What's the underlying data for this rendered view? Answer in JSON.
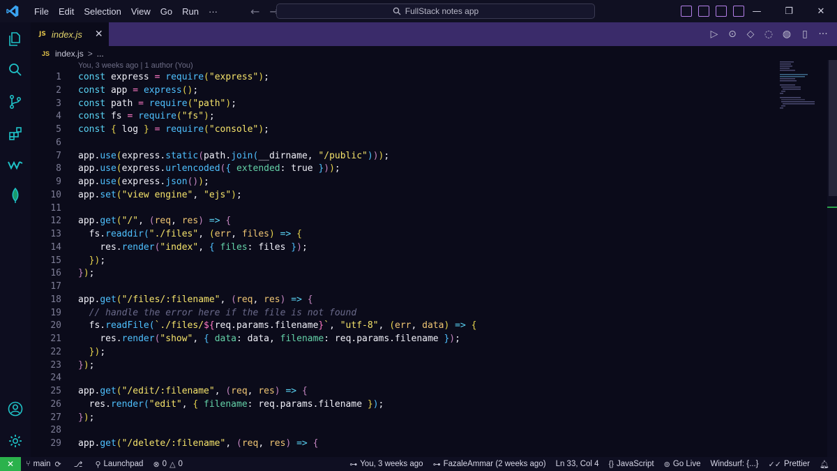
{
  "menu": [
    "File",
    "Edit",
    "Selection",
    "View",
    "Go",
    "Run",
    "···"
  ],
  "command_center": "FullStack notes app",
  "window_controls": {
    "minimize": "—",
    "restore": "❐",
    "close": "✕"
  },
  "tab": {
    "lang": "JS",
    "name": "index.js",
    "close": "✕"
  },
  "breadcrumb": {
    "lang": "JS",
    "file": "index.js",
    "sep": ">",
    "more": "..."
  },
  "codelens": "You, 3 weeks ago | 1 author (You)",
  "editor_actions": [
    "▷",
    "⊙",
    "◇",
    "◌",
    "◍",
    "▯",
    "···"
  ],
  "code_lines": [
    {
      "n": "1",
      "html": "<span class='kw'>const</span> <span class='var'>express</span> <span class='op'>=</span> <span class='fn'>require</span><span class='pun'>(</span><span class='str'>\"express\"</span><span class='pun'>)</span><span class='var'>;</span>"
    },
    {
      "n": "2",
      "html": "<span class='kw'>const</span> <span class='var'>app</span> <span class='op'>=</span> <span class='fn'>express</span><span class='pun'>()</span><span class='var'>;</span>"
    },
    {
      "n": "3",
      "html": "<span class='kw'>const</span> <span class='var'>path</span> <span class='op'>=</span> <span class='fn'>require</span><span class='pun'>(</span><span class='str'>\"path\"</span><span class='pun'>)</span><span class='var'>;</span>"
    },
    {
      "n": "4",
      "html": "<span class='kw'>const</span> <span class='var'>fs</span> <span class='op'>=</span> <span class='fn'>require</span><span class='pun'>(</span><span class='str'>\"fs\"</span><span class='pun'>)</span><span class='var'>;</span>"
    },
    {
      "n": "5",
      "html": "<span class='kw'>const</span> <span class='pun'>{</span> <span class='var'>log</span> <span class='pun'>}</span> <span class='op'>=</span> <span class='fn'>require</span><span class='pun'>(</span><span class='str'>\"console\"</span><span class='pun'>)</span><span class='var'>;</span>"
    },
    {
      "n": "6",
      "html": ""
    },
    {
      "n": "7",
      "html": "<span class='var'>app.</span><span class='fn'>use</span><span class='pun'>(</span><span class='var'>express.</span><span class='fn'>static</span><span class='brk2'>(</span><span class='var'>path.</span><span class='fn'>join</span><span class='fn'>(</span><span class='var'>__dirname, </span><span class='str'>\"/public\"</span><span class='fn'>)</span><span class='brk2'>)</span><span class='pun'>)</span><span class='var'>;</span>"
    },
    {
      "n": "8",
      "html": "<span class='var'>app.</span><span class='fn'>use</span><span class='pun'>(</span><span class='var'>express.</span><span class='fn'>urlencoded</span><span class='brk2'>(</span><span class='fn'>{</span> <span class='prop'>extended</span><span class='var'>:</span> <span class='bool'>true</span> <span class='fn'>}</span><span class='brk2'>)</span><span class='pun'>)</span><span class='var'>;</span>"
    },
    {
      "n": "9",
      "html": "<span class='var'>app.</span><span class='fn'>use</span><span class='pun'>(</span><span class='var'>express.</span><span class='fn'>json</span><span class='brk2'>()</span><span class='pun'>)</span><span class='var'>;</span>"
    },
    {
      "n": "10",
      "html": "<span class='var'>app.</span><span class='fn'>set</span><span class='pun'>(</span><span class='str'>\"view engine\"</span><span class='var'>, </span><span class='str'>\"ejs\"</span><span class='pun'>)</span><span class='var'>;</span>"
    },
    {
      "n": "11",
      "html": ""
    },
    {
      "n": "12",
      "html": "<span class='var'>app.</span><span class='fn'>get</span><span class='pun'>(</span><span class='str'>\"/\"</span><span class='var'>, </span><span class='brk2'>(</span><span class='param'>req</span><span class='var'>, </span><span class='param'>res</span><span class='brk2'>)</span> <span class='kw'>=&gt;</span> <span class='brk2'>{</span>"
    },
    {
      "n": "13",
      "html": "  <span class='var'>fs.</span><span class='fn'>readdir</span><span class='fn'>(</span><span class='str'>\"./files\"</span><span class='var'>, </span><span class='pun'>(</span><span class='param'>err</span><span class='var'>, </span><span class='param'>files</span><span class='pun'>)</span> <span class='kw'>=&gt;</span> <span class='pun'>{</span>"
    },
    {
      "n": "14",
      "html": "    <span class='var'>res.</span><span class='fn'>render</span><span class='brk2'>(</span><span class='str'>\"index\"</span><span class='var'>, </span><span class='fn'>{</span> <span class='prop'>files</span><span class='var'>: files </span><span class='fn'>}</span><span class='brk2'>)</span><span class='var'>;</span>"
    },
    {
      "n": "15",
      "html": "  <span class='pun'>})</span><span class='var'>;</span>"
    },
    {
      "n": "16",
      "html": "<span class='brk2'>}</span><span class='pun'>)</span><span class='var'>;</span>"
    },
    {
      "n": "17",
      "html": ""
    },
    {
      "n": "18",
      "html": "<span class='var'>app.</span><span class='fn'>get</span><span class='pun'>(</span><span class='str'>\"/files/:filename\"</span><span class='var'>, </span><span class='brk2'>(</span><span class='param'>req</span><span class='var'>, </span><span class='param'>res</span><span class='brk2'>)</span> <span class='kw'>=&gt;</span> <span class='brk2'>{</span>"
    },
    {
      "n": "19",
      "html": "  <span class='cmt'>// handle the error here if the file is not found</span>"
    },
    {
      "n": "20",
      "html": "  <span class='var'>fs.</span><span class='fn'>readFile</span><span class='fn'>(</span><span class='tpl'>`./files/</span><span class='op'>${</span><span class='var'>req.params.filename</span><span class='op'>}</span><span class='tpl'>`</span><span class='var'>, </span><span class='str'>\"utf-8\"</span><span class='var'>, </span><span class='pun'>(</span><span class='param'>err</span><span class='var'>, </span><span class='param'>data</span><span class='pun'>)</span> <span class='kw'>=&gt;</span> <span class='pun'>{</span>"
    },
    {
      "n": "21",
      "html": "    <span class='var'>res.</span><span class='fn'>render</span><span class='brk2'>(</span><span class='str'>\"show\"</span><span class='var'>, </span><span class='fn'>{</span> <span class='prop'>data</span><span class='var'>: data, </span><span class='prop'>filename</span><span class='var'>: req.params.filename </span><span class='fn'>}</span><span class='brk2'>)</span><span class='var'>;</span>"
    },
    {
      "n": "22",
      "html": "  <span class='pun'>})</span><span class='var'>;</span>"
    },
    {
      "n": "23",
      "html": "<span class='brk2'>}</span><span class='pun'>)</span><span class='var'>;</span>"
    },
    {
      "n": "24",
      "html": ""
    },
    {
      "n": "25",
      "html": "<span class='var'>app.</span><span class='fn'>get</span><span class='pun'>(</span><span class='str'>\"/edit/:filename\"</span><span class='var'>, </span><span class='brk2'>(</span><span class='param'>req</span><span class='var'>, </span><span class='param'>res</span><span class='brk2'>)</span> <span class='kw'>=&gt;</span> <span class='brk2'>{</span>"
    },
    {
      "n": "26",
      "html": "  <span class='var'>res.</span><span class='fn'>render</span><span class='fn'>(</span><span class='str'>\"edit\"</span><span class='var'>, </span><span class='pun'>{</span> <span class='prop'>filename</span><span class='var'>: req.params.filename </span><span class='pun'>}</span><span class='fn'>)</span><span class='var'>;</span>"
    },
    {
      "n": "27",
      "html": "<span class='brk2'>}</span><span class='pun'>)</span><span class='var'>;</span>"
    },
    {
      "n": "28",
      "html": ""
    },
    {
      "n": "29",
      "html": "<span class='var'>app.</span><span class='fn'>get</span><span class='pun'>(</span><span class='str'>\"/delete/:filename\"</span><span class='var'>, </span><span class='brk2'>(</span><span class='param'>req</span><span class='var'>, </span><span class='param'>res</span><span class='brk2'>)</span> <span class='kw'>=&gt;</span> <span class='brk2'>{</span>"
    }
  ],
  "status": {
    "remote": "✕",
    "branch": "main",
    "launchpad": "Launchpad",
    "errors": "0",
    "warnings": "0",
    "blame": "You, 3 weeks ago",
    "author": "FazaleAmmar (2 weeks ago)",
    "position": "Ln 33, Col 4",
    "language": "JavaScript",
    "golive": "Go Live",
    "windsurf": "Windsurf: {...}",
    "prettier": "Prettier"
  },
  "colors": {
    "accent": "#b37fe8",
    "remote": "#2bb24c",
    "tabbar": "#3a2b6a"
  }
}
